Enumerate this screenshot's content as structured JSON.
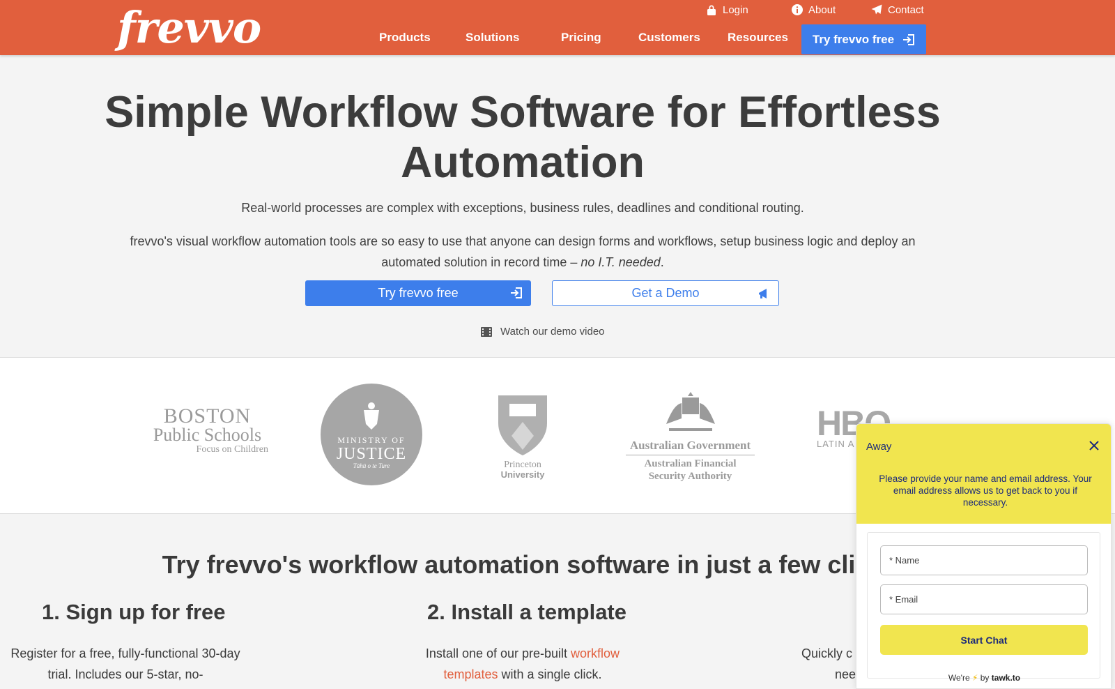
{
  "header": {
    "logo_text": "frevvo",
    "util_links": [
      {
        "label": "Login",
        "icon": "lock-icon"
      },
      {
        "label": "About",
        "icon": "info-icon"
      },
      {
        "label": "Contact",
        "icon": "paper-plane-icon"
      }
    ],
    "nav": [
      "Products",
      "Solutions",
      "Pricing",
      "Customers",
      "Resources"
    ],
    "cta_label": "Try frevvo free",
    "brand_color": "#e15f3d",
    "accent_color": "#3d7eeb"
  },
  "hero": {
    "title": "Simple Workflow Software for Effortless Automation",
    "subtitle1": "Real-world processes are complex with exceptions, business rules, deadlines and conditional routing.",
    "subtitle2": "frevvo's visual workflow automation tools are so easy to use that anyone can design forms and workflows, setup business logic and deploy an automated solution in record time – ",
    "subtitle2_em": "no I.T. needed",
    "subtitle2_end": ".",
    "primary_button": "Try frevvo free",
    "secondary_button": "Get a Demo",
    "video_link": "Watch our demo video"
  },
  "logos": {
    "boston": {
      "line1": "BOSTON",
      "line2": "Public Schools",
      "line3": "Focus on Children"
    },
    "moj": {
      "line1": "MINISTRY OF",
      "line2": "JUSTICE",
      "line3": "Tāhū o te Ture"
    },
    "princeton": {
      "line1": "Princeton",
      "line2": "University"
    },
    "aus": {
      "line1": "Australian Government",
      "line2": "Australian Financial",
      "line3": "Security Authority"
    },
    "hbo": {
      "line1": "HBO",
      "line2": "LATIN A"
    }
  },
  "steps": {
    "title": "Try frevvo's workflow automation software in just a few clic",
    "step1": {
      "heading": "1. Sign up for free",
      "text": "Register for a free, fully-functional 30-day trial. Includes our 5-star, no-"
    },
    "step2": {
      "heading": "2. Install a template",
      "text_pre": "Install one of our pre-built ",
      "link": "workflow templates",
      "text_post": " with a single click."
    },
    "step3": {
      "text_line1": "Quickly c",
      "text_line2": "nee"
    }
  },
  "chat": {
    "status": "Away",
    "message": "Please provide your name and email address. Your email address allows us to get back to you if necessary.",
    "name_placeholder": "* Name",
    "email_placeholder": "* Email",
    "start_button": "Start Chat",
    "footer_pre": "We're",
    "footer_bolt": "⚡",
    "footer_by": "by",
    "footer_brand": "tawk.to",
    "widget_color": "#f1e54f"
  }
}
